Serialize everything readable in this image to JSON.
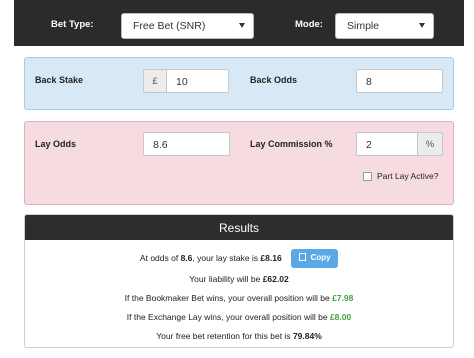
{
  "topbar": {
    "bet_type_label": "Bet Type:",
    "bet_type_value": "Free Bet (SNR)",
    "mode_label": "Mode:",
    "mode_value": "Simple"
  },
  "back": {
    "stake_label": "Back Stake",
    "currency": "£",
    "stake_value": "10",
    "odds_label": "Back Odds",
    "odds_value": "8"
  },
  "lay": {
    "odds_label": "Lay Odds",
    "odds_value": "8.6",
    "commission_label": "Lay Commission %",
    "commission_value": "2",
    "percent": "%",
    "part_lay_label": "Part Lay Active?"
  },
  "results": {
    "title": "Results",
    "line1_prefix": "At odds of ",
    "line1_odds": "8.6",
    "line1_mid": ", your lay stake is ",
    "line1_stake": "£8.16",
    "copy_label": "Copy",
    "line2_prefix": "Your liability will be ",
    "line2_value": "£62.02",
    "line3_prefix": "If the Bookmaker Bet wins, your overall position will be ",
    "line3_value": "£7.98",
    "line4_prefix": "If the Exchange Lay wins, your overall position will be ",
    "line4_value": "£8.00",
    "line5_prefix": "Your free bet retention for this bet is ",
    "line5_value": "79.84%"
  },
  "colors": {
    "topbar": "#2b2b2b",
    "back_panel": "#d7e9f7",
    "lay_panel": "#f6dce0",
    "copy_button": "#5aa9e6",
    "positive": "#3fa43f"
  }
}
